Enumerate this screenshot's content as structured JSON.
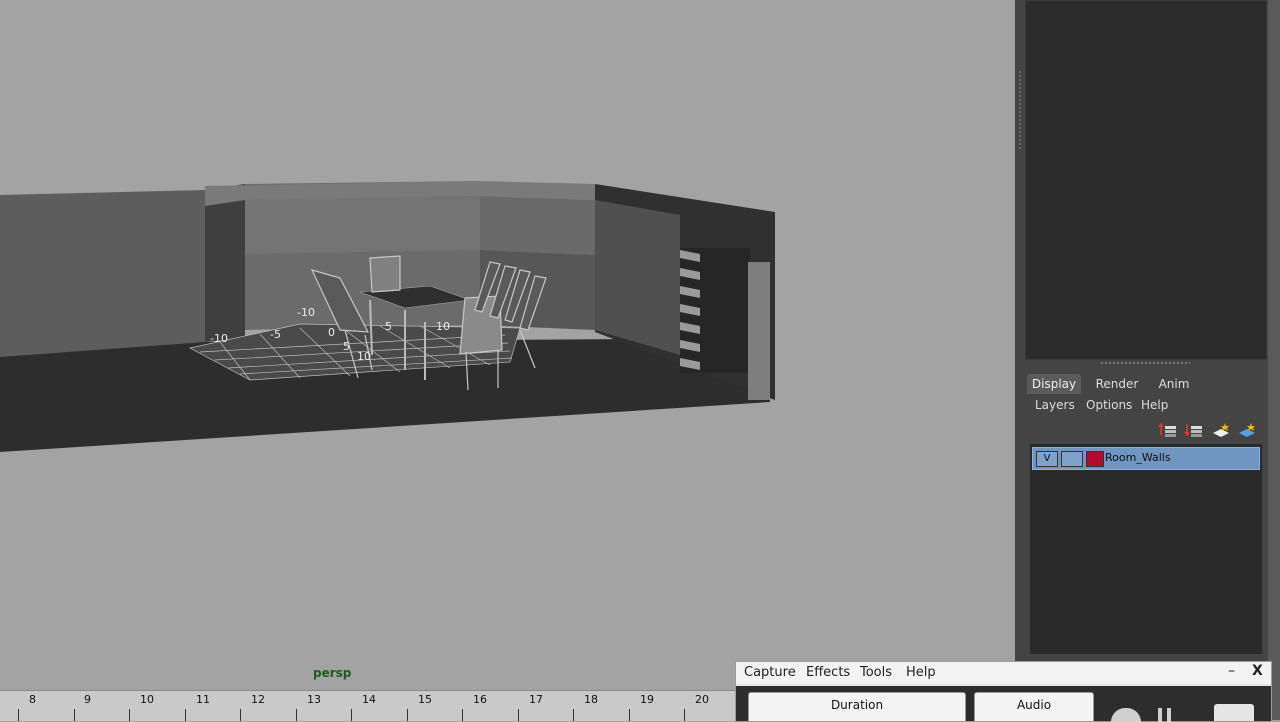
{
  "viewport": {
    "camera_label": "persp",
    "grid_numbers": [
      "-10",
      "-5",
      "0",
      "5",
      "10",
      "-10",
      "5",
      "10"
    ]
  },
  "timeline": {
    "ticks": [
      "8",
      "9",
      "10",
      "11",
      "12",
      "13",
      "14",
      "15",
      "16",
      "17",
      "18",
      "19",
      "20"
    ]
  },
  "layer_editor": {
    "tabs": [
      "Display",
      "Render",
      "Anim"
    ],
    "active_tab": "Display",
    "menu": [
      "Layers",
      "Options",
      "Help"
    ],
    "icons": [
      "move-layer-up-icon",
      "move-layer-down-icon",
      "new-layer-icon",
      "new-layer-from-selected-icon"
    ],
    "layers": [
      {
        "visibility": "V",
        "name": "Room_Walls",
        "color": "#b00c30"
      }
    ]
  },
  "capture_window": {
    "menu": [
      "Capture",
      "Effects",
      "Tools",
      "Help"
    ],
    "minimize": "–",
    "close": "X",
    "tabs": [
      "Duration",
      "Audio"
    ]
  }
}
